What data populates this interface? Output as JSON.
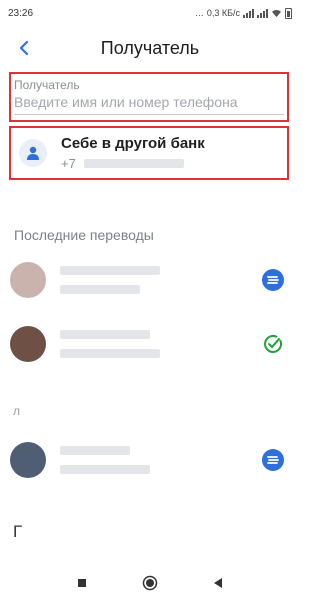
{
  "status_bar": {
    "time": "23:26",
    "net_speed": "0,3 КБ/с"
  },
  "header": {
    "title": "Получатель"
  },
  "recipient_field": {
    "label": "Получатель",
    "placeholder": "Введите имя или номер телефона",
    "value": ""
  },
  "self_transfer": {
    "title": "Себе в другой банк",
    "phone_prefix": "+7"
  },
  "recent": {
    "title": "Последние переводы"
  },
  "section_letters": {
    "first": "л",
    "second": "Г"
  },
  "colors": {
    "accent_blue": "#2f6fdc",
    "highlight_red": "#d9343a",
    "sber_green": "#21a038"
  },
  "icons": {
    "back": "arrow-back-icon",
    "self_avatar": "person-icon",
    "badge_blue": "bank-card-icon",
    "badge_green": "sber-check-icon",
    "nav": [
      "square-nav-icon",
      "circle-home-icon",
      "triangle-back-icon"
    ]
  }
}
